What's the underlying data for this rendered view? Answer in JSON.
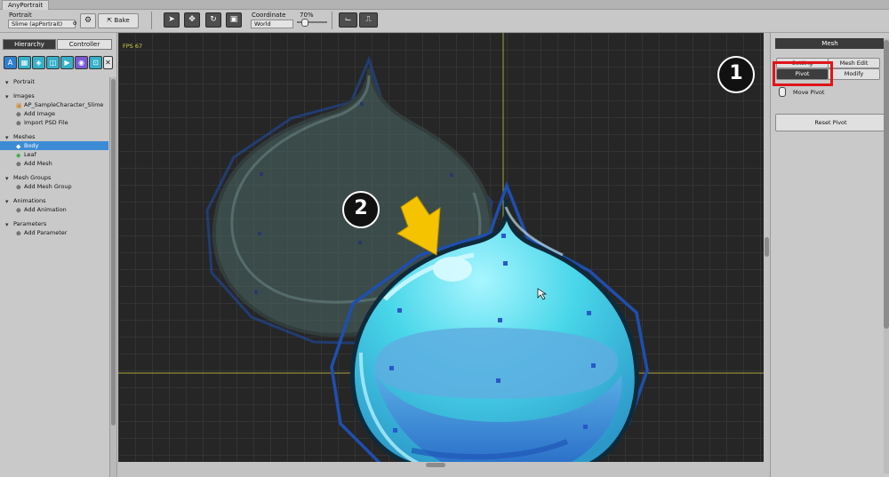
{
  "window": {
    "tab_title": "AnyPortrait"
  },
  "toolbar": {
    "portrait_label": "Portrait",
    "portrait_value": "Slime (apPortrait)",
    "portrait_dot": "o",
    "bake_label": "Bake",
    "coordinate_label": "Coordinate",
    "coordinate_value": "World",
    "zoom_label": "70%"
  },
  "left_panel": {
    "hierarchy_tab": "Hierarchy",
    "controller_tab": "Controller",
    "tree": [
      {
        "label": "Portrait",
        "kind": "section"
      },
      {
        "label": "Images",
        "kind": "section"
      },
      {
        "label": "AP_SampleCharacter_Slime",
        "kind": "image"
      },
      {
        "label": "Add Image",
        "kind": "add"
      },
      {
        "label": "Import PSD File",
        "kind": "add"
      },
      {
        "label": "Meshes",
        "kind": "section"
      },
      {
        "label": "Body",
        "kind": "mesh",
        "selected": true
      },
      {
        "label": "Leaf",
        "kind": "mesh"
      },
      {
        "label": "Add Mesh",
        "kind": "add"
      },
      {
        "label": "Mesh Groups",
        "kind": "section"
      },
      {
        "label": "Add Mesh Group",
        "kind": "add"
      },
      {
        "label": "Animations",
        "kind": "section"
      },
      {
        "label": "Add Animation",
        "kind": "add"
      },
      {
        "label": "Parameters",
        "kind": "section"
      },
      {
        "label": "Add Parameter",
        "kind": "add"
      }
    ]
  },
  "viewport": {
    "fps": "FPS 67"
  },
  "right_panel": {
    "header": "Mesh",
    "setting_tab": "Setting",
    "mesh_edit_tab": "Mesh Edit",
    "pivot_tab": "Pivot",
    "modify_tab": "Modify",
    "move_pivot_label": "Move Pivot",
    "reset_pivot_label": "Reset Pivot"
  },
  "annotations": {
    "step1": "1",
    "step2": "2"
  },
  "colors": {
    "highlight": "#e0141b",
    "arrow": "#f5c300",
    "selected_row": "#3d8bd4",
    "mesh_outline": "#1e4fb0",
    "slime": "#46d6e8"
  }
}
